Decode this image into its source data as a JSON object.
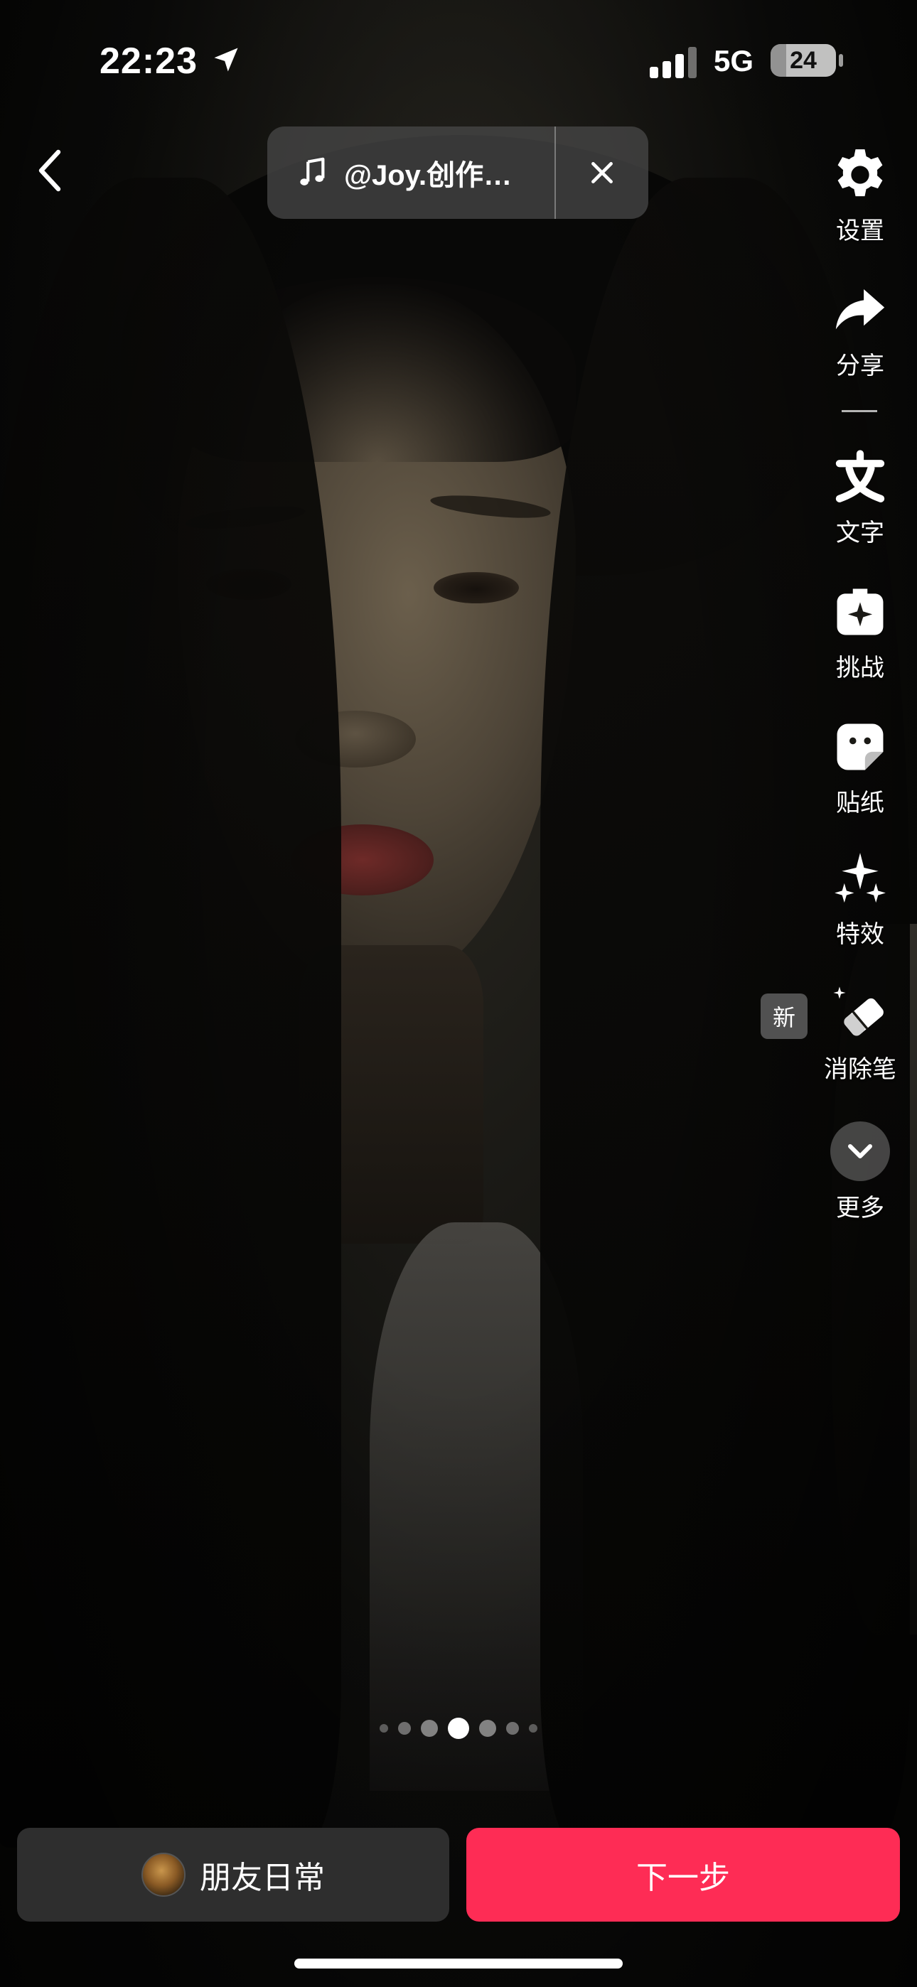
{
  "status_bar": {
    "time": "22:23",
    "network": "5G",
    "battery_level": "24",
    "battery_fraction": 0.24
  },
  "music": {
    "title": "@Joy.创作…"
  },
  "toolbar": {
    "settings_label": "设置",
    "share_label": "分享",
    "text_label": "文字",
    "challenge_label": "挑战",
    "sticker_label": "贴纸",
    "effects_label": "特效",
    "eraser_label": "消除笔",
    "new_badge": "新",
    "more_label": "更多"
  },
  "pagination": {
    "count": 7,
    "active_index": 3
  },
  "bottom": {
    "friends_label": "朋友日常",
    "next_label": "下一步"
  },
  "colors": {
    "accent": "#fe2c55",
    "secondary_button": "#2e2e2e"
  }
}
